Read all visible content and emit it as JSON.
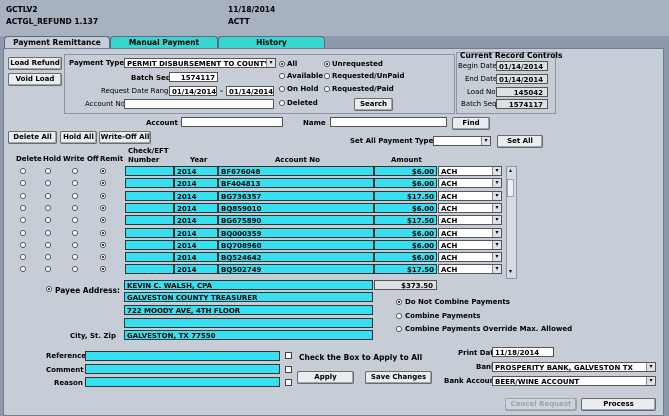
{
  "header": {
    "app_code": "GCTLV2",
    "module": "ACTGL_REFUND 1.137",
    "date": "11/18/2014",
    "user": "ACTT"
  },
  "tabs": [
    {
      "label": "Payment Remittance",
      "active": true
    },
    {
      "label": "Manual Payment Requests",
      "active": false
    },
    {
      "label": "History",
      "active": false
    }
  ],
  "buttons": {
    "load_refund": "Load Refund",
    "void_load": "Void Load",
    "search": "Search",
    "find": "Find",
    "delete_all": "Delete All",
    "hold_all": "Hold All",
    "write_off_all": "Write-Off All",
    "set_all": "Set All",
    "apply": "Apply",
    "save_changes": "Save Changes",
    "cancel_request": "Cancel Request",
    "process": "Process"
  },
  "filters": {
    "payment_type_label": "Payment Type",
    "payment_type_value": "PERMIT DISBURSEMENT TO COUNTY",
    "batch_seq_label": "Batch Seq",
    "batch_seq_value": "1574117",
    "request_date_range_label": "Request Date Range",
    "date_from": "01/14/2014",
    "date_sep": "-",
    "date_to": "01/14/2014",
    "account_no_label": "Account No",
    "account_no_value": "",
    "status_radios": [
      {
        "label": "All",
        "selected": true
      },
      {
        "label": "Available",
        "selected": false
      },
      {
        "label": "On Hold",
        "selected": false
      },
      {
        "label": "Deleted",
        "selected": false
      }
    ],
    "request_radios": [
      {
        "label": "Unrequested",
        "selected": true
      },
      {
        "label": "Requested/UnPaid",
        "selected": false
      },
      {
        "label": "Requested/Paid",
        "selected": false
      }
    ]
  },
  "current_record_controls": {
    "title": "Current Record Controls",
    "rows": [
      {
        "label": "Begin Date",
        "value": "01/14/2014"
      },
      {
        "label": "End Date",
        "value": "01/14/2014"
      },
      {
        "label": "Load No.",
        "value": "145042"
      },
      {
        "label": "Batch Seq",
        "value": "1574117"
      }
    ]
  },
  "find_bar": {
    "account_no_label": "Account No",
    "account_no_value": "",
    "name_label": "Name",
    "name_value": ""
  },
  "set_all_payment_types_label": "Set All Payment Types",
  "grid": {
    "headers": {
      "delete": "Delete",
      "hold": "Hold",
      "write_off": "Write Off",
      "remit": "Remit",
      "check_eft": "Check/EFT",
      "number": "Number",
      "year": "Year",
      "account_no": "Account No",
      "amount": "Amount"
    },
    "rows": [
      {
        "check": "",
        "year": "2014",
        "account": "BF676048",
        "amount": "$6.00",
        "type": "ACH"
      },
      {
        "check": "",
        "year": "2014",
        "account": "BF404813",
        "amount": "$6.00",
        "type": "ACH"
      },
      {
        "check": "",
        "year": "2014",
        "account": "BG736357",
        "amount": "$17.50",
        "type": "ACH"
      },
      {
        "check": "",
        "year": "2014",
        "account": "BQ859010",
        "amount": "$6.00",
        "type": "ACH"
      },
      {
        "check": "",
        "year": "2014",
        "account": "BG675890",
        "amount": "$17.50",
        "type": "ACH"
      },
      {
        "check": "",
        "year": "2014",
        "account": "BQ000359",
        "amount": "$6.00",
        "type": "ACH"
      },
      {
        "check": "",
        "year": "2014",
        "account": "BQ708960",
        "amount": "$6.00",
        "type": "ACH"
      },
      {
        "check": "",
        "year": "2014",
        "account": "BQ524642",
        "amount": "$6.00",
        "type": "ACH"
      },
      {
        "check": "",
        "year": "2014",
        "account": "BQ502749",
        "amount": "$17.50",
        "type": "ACH"
      }
    ]
  },
  "payee": {
    "label": "Payee Address:",
    "lines": [
      "KEVIN C. WALSH, CPA",
      "GALVESTON COUNTY TREASURER",
      "722 MOODY AVE, 4TH FLOOR",
      ""
    ],
    "city_label": "City, St. Zip",
    "city_value": "GALVESTON, TX  77550",
    "total": "$373.50"
  },
  "combine_options": [
    {
      "label": "Do Not Combine Payments",
      "selected": true
    },
    {
      "label": "Combine Payments",
      "selected": false
    },
    {
      "label": "Combine Payments Override Max. Allowed",
      "selected": false
    }
  ],
  "notes": {
    "reference_label": "Reference",
    "comment_label": "Comment",
    "reason_label": "Reason",
    "check_box_label": "Check the Box to Apply to All"
  },
  "print": {
    "print_date_label": "Print Date",
    "print_date_value": "11/18/2014",
    "bank_label": "Bank",
    "bank_value": "PROSPERITY BANK, GALVESTON TX",
    "bank_account_label": "Bank Account",
    "bank_account_value": "BEER/WINE ACCOUNT"
  }
}
